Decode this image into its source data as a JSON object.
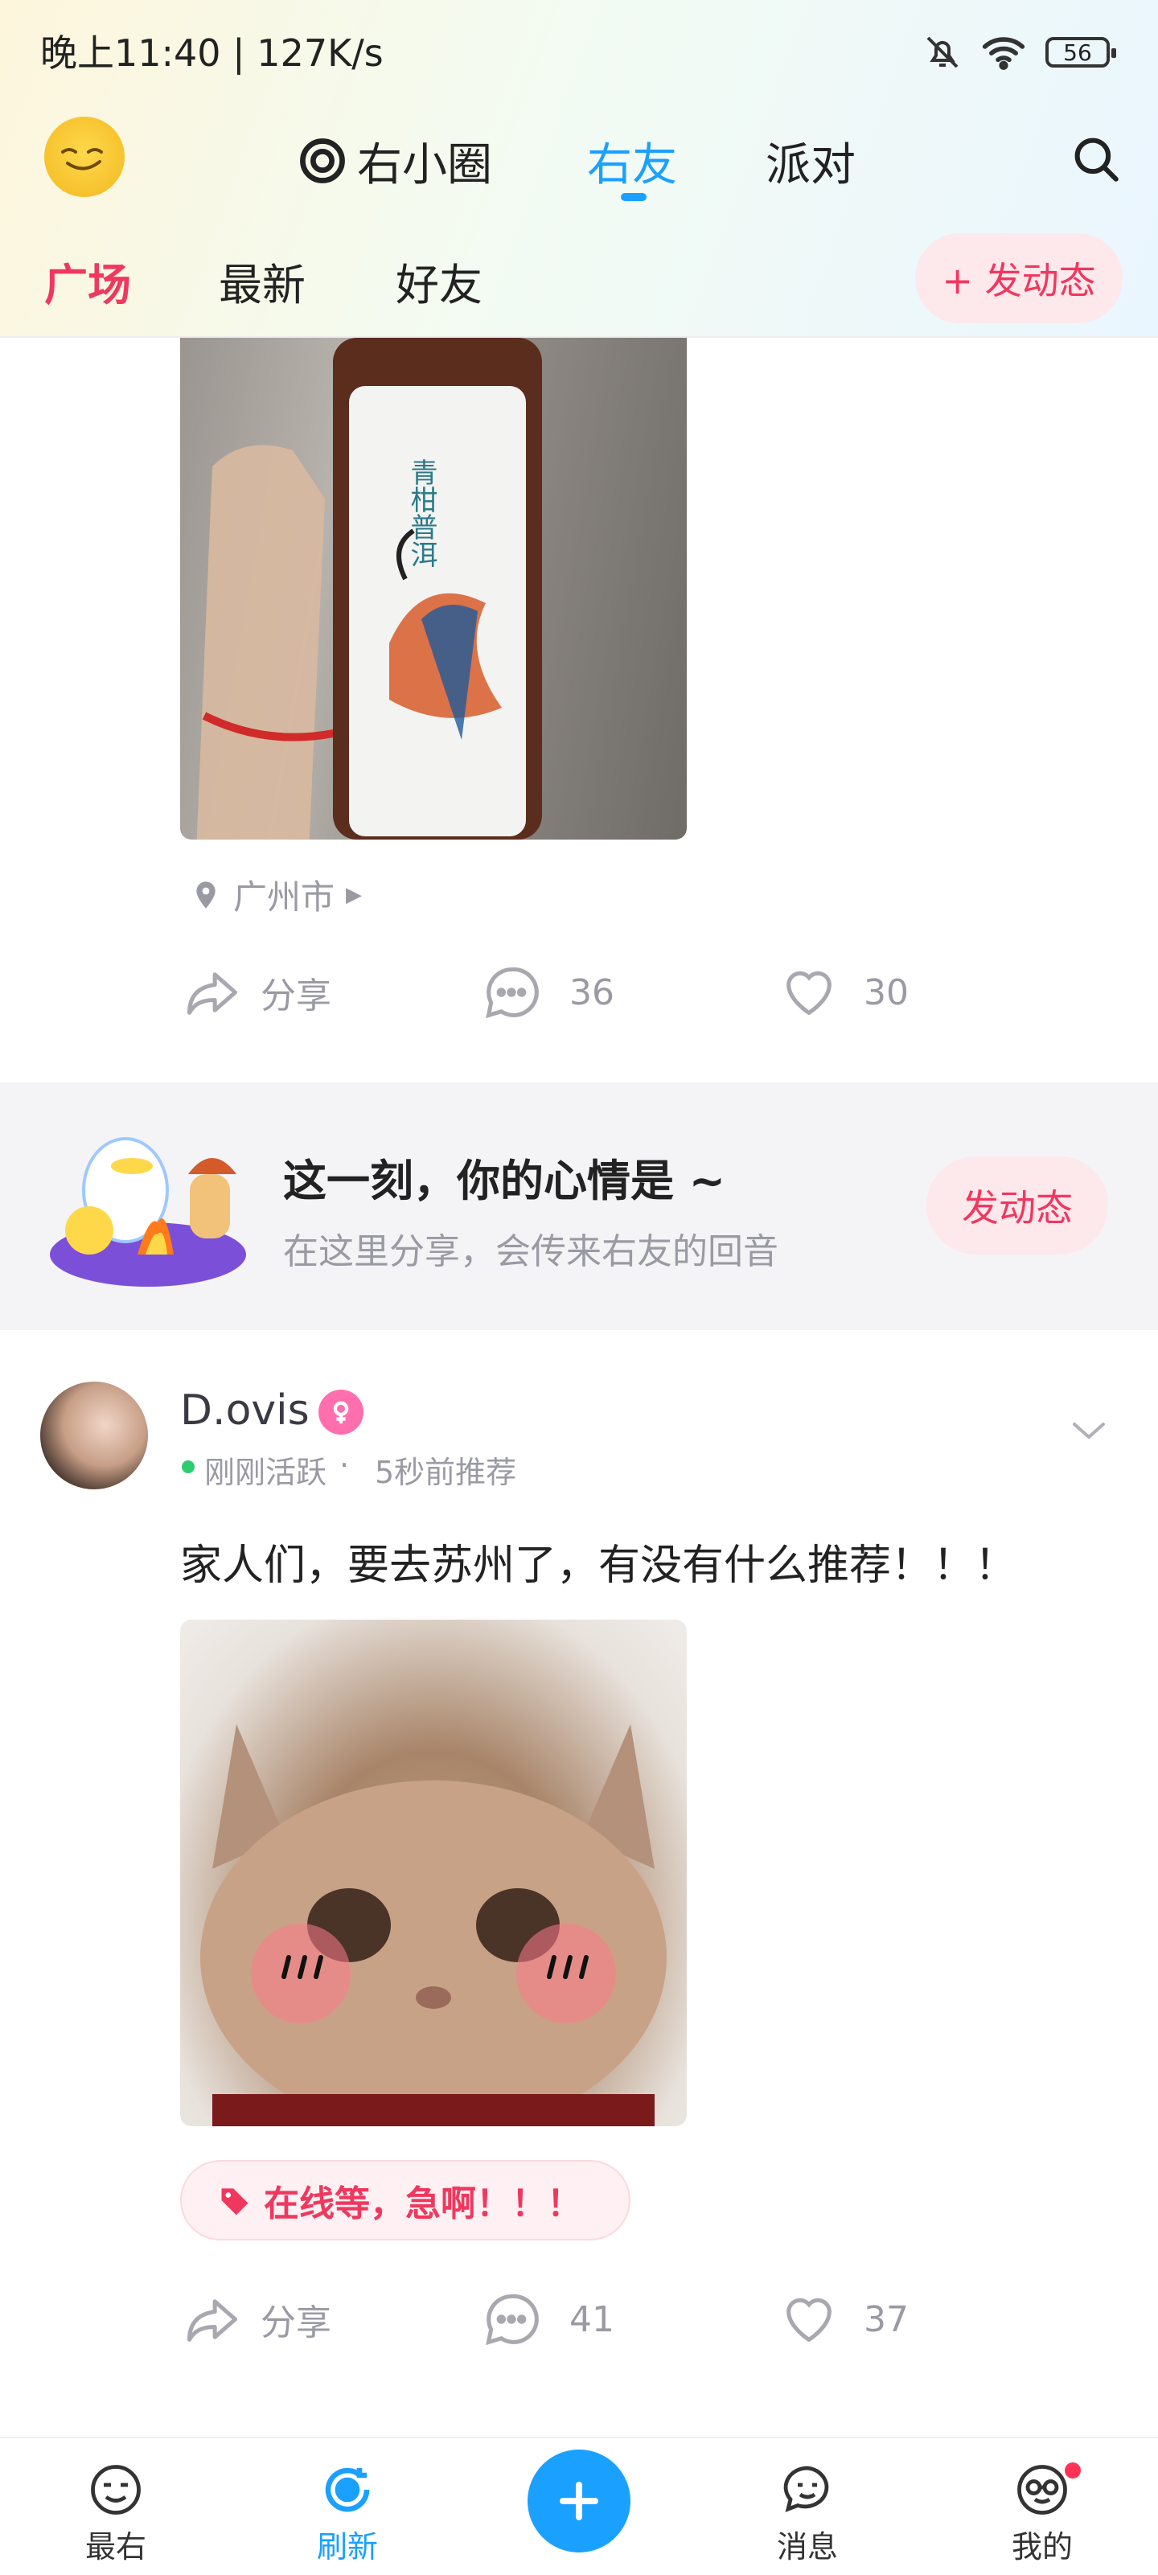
{
  "status_bar": {
    "time": "晚上11:40 | 127K/s",
    "battery": "56",
    "icons": [
      "mute-bell-icon",
      "wifi-icon",
      "battery-icon"
    ]
  },
  "top_nav": {
    "items": [
      {
        "label": "右小圈",
        "icon": "circle-at-icon"
      },
      {
        "label": "右友",
        "active": true
      },
      {
        "label": "派对"
      }
    ],
    "search_icon": "search-icon"
  },
  "sub_nav": {
    "items": [
      "广场",
      "最新",
      "好友"
    ],
    "active": "广场",
    "post_button": "+ 发动态"
  },
  "post1": {
    "image_desc_text": "青柑普洱",
    "location": "广州市",
    "share": "分享",
    "comments": "36",
    "likes": "30"
  },
  "mood_card": {
    "title": "这一刻，你的心情是 ~",
    "subtitle": "在这里分享，会传来右友的回音",
    "button": "发动态"
  },
  "post2": {
    "username": "D.ovis",
    "gender_icon": "female-icon",
    "active_status": "刚刚活跃",
    "recommend_time": "5秒前推荐",
    "text": "家人们，要去苏州了，有没有什么推荐！！！",
    "tag": "在线等，急啊！！！",
    "share": "分享",
    "comments": "41",
    "likes": "37"
  },
  "tab_bar": {
    "items": [
      {
        "label": "最右",
        "icon": "face-icon"
      },
      {
        "label": "刷新",
        "icon": "refresh-icon",
        "active": true
      },
      {
        "label": "",
        "icon": "plus-icon"
      },
      {
        "label": "消息",
        "icon": "message-icon"
      },
      {
        "label": "我的",
        "icon": "profile-icon",
        "badge": true
      }
    ]
  },
  "colors": {
    "accent_blue": "#1aa0ff",
    "accent_pink": "#f0385f",
    "pink_bg": "#fde8ec",
    "online_green": "#2ecc71"
  }
}
